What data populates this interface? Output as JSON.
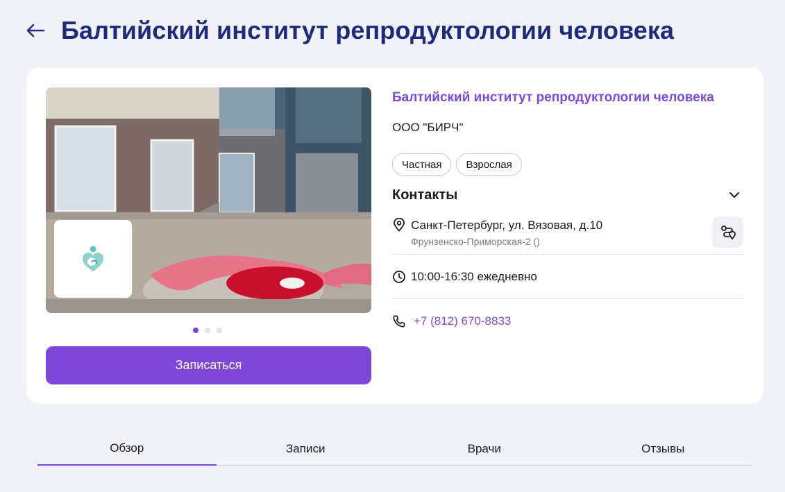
{
  "header": {
    "back_icon": "arrow-left-icon",
    "title": "Балтийский институт репродуктологии человека"
  },
  "clinic": {
    "name": "Балтийский институт репродуктологии человека",
    "legal_name": "ООО \"БИРЧ\"",
    "tags": [
      "Частная",
      "Взрослая"
    ],
    "photo_slides_total": 3,
    "photo_slide_active": 1,
    "book_button_label": "Записаться"
  },
  "contacts": {
    "title": "Контакты",
    "address": "Санкт-Петербург, ул. Вязовая, д.10",
    "metro": "Фрунзенско-Приморская-2 ()",
    "hours": "10:00-16:30 ежедневно",
    "phone": "+7 (812) 670-8833"
  },
  "tabs": [
    {
      "label": "Обзор",
      "active": true
    },
    {
      "label": "Записи",
      "active": false
    },
    {
      "label": "Врачи",
      "active": false
    },
    {
      "label": "Отзывы",
      "active": false
    }
  ],
  "colors": {
    "accent": "#7d48d9",
    "title": "#1f2a7a",
    "background": "#f0f2f7"
  }
}
